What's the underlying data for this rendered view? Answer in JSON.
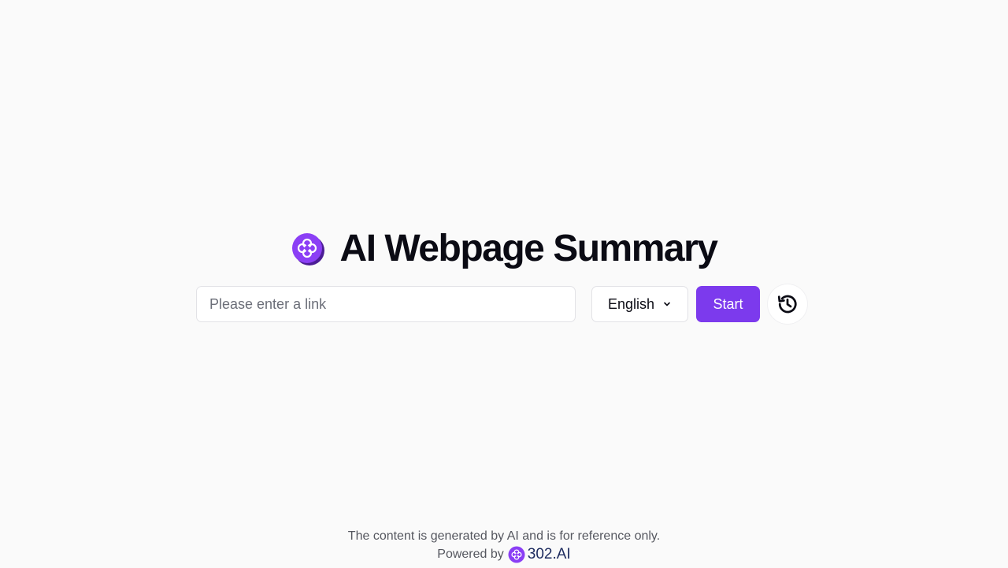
{
  "header": {
    "title": "AI Webpage Summary",
    "logo_icon": "flower-logo-icon"
  },
  "form": {
    "link_placeholder": "Please enter a link",
    "link_value": "",
    "language_selected": "English",
    "start_label": "Start",
    "history_icon": "history-icon"
  },
  "footer": {
    "disclaimer": "The content is generated by AI and is for reference only.",
    "powered_by": "Powered by",
    "brand_name": "302.AI"
  },
  "colors": {
    "accent": "#7c3aed",
    "background": "#fafafa",
    "brand_text": "#1c2a5e"
  }
}
